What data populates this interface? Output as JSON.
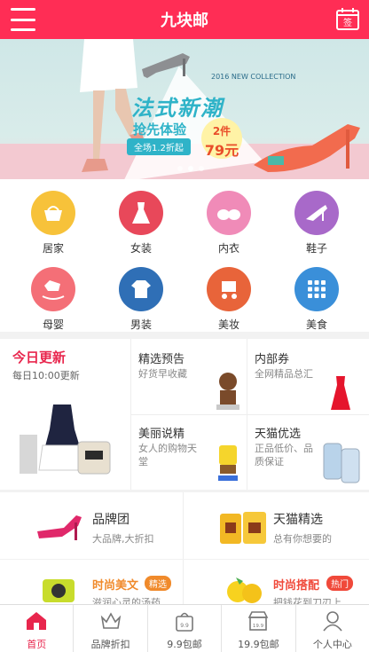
{
  "header": {
    "title": "九块邮",
    "sign_label": "签"
  },
  "banner": {
    "headline": "法式新潮",
    "subline": "抢先体验",
    "discount": "全场1.2折起",
    "collection": "2016 NEW COLLECTION",
    "price_count": "2件",
    "price_value": "79元",
    "slides": 3,
    "active_slide": 1
  },
  "categories": [
    {
      "label": "居家",
      "color": "#f7c23a",
      "icon": "basket-icon"
    },
    {
      "label": "女装",
      "color": "#e8485a",
      "icon": "dress-icon"
    },
    {
      "label": "内衣",
      "color": "#f08bb8",
      "icon": "bra-icon"
    },
    {
      "label": "鞋子",
      "color": "#a869c9",
      "icon": "heel-icon"
    },
    {
      "label": "母婴",
      "color": "#f46f77",
      "icon": "rocking-horse-icon"
    },
    {
      "label": "男装",
      "color": "#2f6fb6",
      "icon": "shirt-icon"
    },
    {
      "label": "美妆",
      "color": "#e8643a",
      "icon": "stroller-icon"
    },
    {
      "label": "美食",
      "color": "#3a8fd9",
      "icon": "grid-icon"
    }
  ],
  "promo": {
    "today": {
      "title": "今日更新",
      "subtitle": "每日10:00更新"
    },
    "cells": [
      {
        "title": "精选预告",
        "subtitle": "好货早收藏"
      },
      {
        "title": "内部券",
        "subtitle": "全网精品总汇"
      },
      {
        "title": "美丽说精",
        "subtitle": "女人的购物天堂"
      },
      {
        "title": "天猫优选",
        "subtitle": "正品低价、品质保证"
      }
    ]
  },
  "brands": [
    {
      "title": "品牌团",
      "subtitle": "大品牌,大折扣"
    },
    {
      "title": "天猫精选",
      "subtitle": "总有你想要的"
    }
  ],
  "fashion": [
    {
      "title": "时尚美文",
      "tag": "精选",
      "tag_color": "#f08a2b",
      "subtitle": "滋润心灵的汤药"
    },
    {
      "title": "时尚搭配",
      "tag": "热门",
      "tag_color": "#f0493a",
      "subtitle": "把钱花到刀刃上"
    }
  ],
  "tabs": [
    {
      "label": "首页",
      "icon": "home-icon",
      "active": true
    },
    {
      "label": "品牌折扣",
      "icon": "crown-icon",
      "active": false
    },
    {
      "label": "9.9包邮",
      "icon": "bag-icon",
      "active": false
    },
    {
      "label": "19.9包邮",
      "icon": "shop-icon",
      "active": false
    },
    {
      "label": "个人中心",
      "icon": "user-icon",
      "active": false
    }
  ]
}
